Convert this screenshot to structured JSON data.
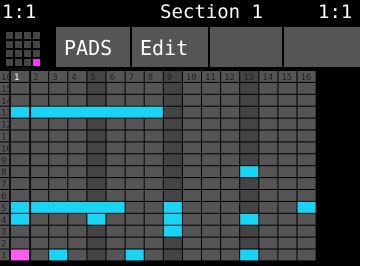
{
  "header": {
    "position_left": "1:1",
    "section_title": "Section 1",
    "position_right": "1:1"
  },
  "tabs": [
    {
      "label": "PADS"
    },
    {
      "label": "Edit"
    },
    {
      "label": ""
    },
    {
      "label": ""
    }
  ],
  "colors": {
    "note": "#19d4f5",
    "playhead_note": "#ff5cf0",
    "cell": "#555555",
    "cell_alt": "#444444",
    "grid_line": "#2e2e2e",
    "background": "#000000"
  },
  "column_numbers": [
    "1",
    "2",
    "3",
    "4",
    "5",
    "6",
    "7",
    "8",
    "9",
    "10",
    "11",
    "12",
    "13",
    "14",
    "15",
    "16"
  ],
  "row_numbers": [
    "16",
    "15",
    "14",
    "13",
    "12",
    "11",
    "10",
    "9",
    "8",
    "7",
    "6",
    "5",
    "4",
    "3",
    "2",
    "1"
  ],
  "playhead_step": "1",
  "notes": [
    {
      "row": "13",
      "start": 1,
      "length": 1,
      "color": "note"
    },
    {
      "row": "13",
      "start": 2,
      "length": 7,
      "color": "note"
    },
    {
      "row": "8",
      "start": 13,
      "length": 1,
      "color": "note"
    },
    {
      "row": "5",
      "start": 1,
      "length": 1,
      "color": "note"
    },
    {
      "row": "5",
      "start": 2,
      "length": 5,
      "color": "note"
    },
    {
      "row": "5",
      "start": 9,
      "length": 1,
      "color": "note"
    },
    {
      "row": "5",
      "start": 16,
      "length": 1,
      "color": "note"
    },
    {
      "row": "4",
      "start": 1,
      "length": 1,
      "color": "note"
    },
    {
      "row": "4",
      "start": 5,
      "length": 1,
      "color": "note"
    },
    {
      "row": "4",
      "start": 9,
      "length": 1,
      "color": "note"
    },
    {
      "row": "4",
      "start": 13,
      "length": 1,
      "color": "note"
    },
    {
      "row": "3",
      "start": 9,
      "length": 1,
      "color": "note"
    },
    {
      "row": "1",
      "start": 1,
      "length": 1,
      "color": "playhead_note"
    },
    {
      "row": "1",
      "start": 3,
      "length": 1,
      "color": "note"
    },
    {
      "row": "1",
      "start": 7,
      "length": 1,
      "color": "note"
    },
    {
      "row": "1",
      "start": 13,
      "length": 1,
      "color": "note"
    }
  ]
}
